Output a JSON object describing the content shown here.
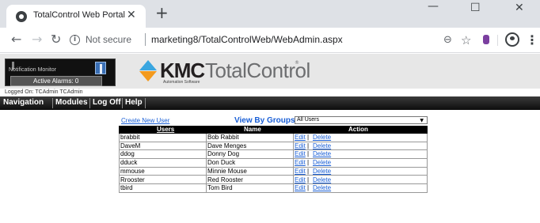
{
  "browser": {
    "tab_title": "TotalControl Web Portal",
    "security_label": "Not secure",
    "url": "marketing8/TotalControlWeb/WebAdmin.aspx"
  },
  "header": {
    "notification_title": "Notification Monitor",
    "active_alarms": "Active Alarms: 0",
    "logo_kmc": "KMC",
    "logo_product": "TotalControl",
    "logo_registered": "®",
    "logo_tagline": "Automation Software"
  },
  "logged_on": "Logged On: TCAdmin TCAdmin",
  "menu": [
    "Navigation",
    "Modules",
    "Log Off",
    "Help"
  ],
  "users_admin": {
    "create_link": "Create New User",
    "view_by_groups_label": "View By Groups:",
    "group_selected": "All Users",
    "columns": [
      "Users",
      "Name",
      "Action"
    ],
    "edit_label": "Edit",
    "delete_label": "Delete",
    "rows": [
      {
        "user": "brabbit",
        "name": "Bob Rabbit"
      },
      {
        "user": "DaveM",
        "name": "Dave Menges"
      },
      {
        "user": "ddog",
        "name": "Donny Dog"
      },
      {
        "user": "dduck",
        "name": "Don Duck"
      },
      {
        "user": "mmouse",
        "name": "Minnie Mouse"
      },
      {
        "user": "Rrooster",
        "name": "Red Rooster"
      },
      {
        "user": "tbird",
        "name": "Tom Bird"
      }
    ]
  },
  "colors": {
    "link": "#1a5fd6",
    "menubar": "#111111",
    "logo_blue": "#3aa6e0",
    "logo_orange": "#f39a1e"
  }
}
